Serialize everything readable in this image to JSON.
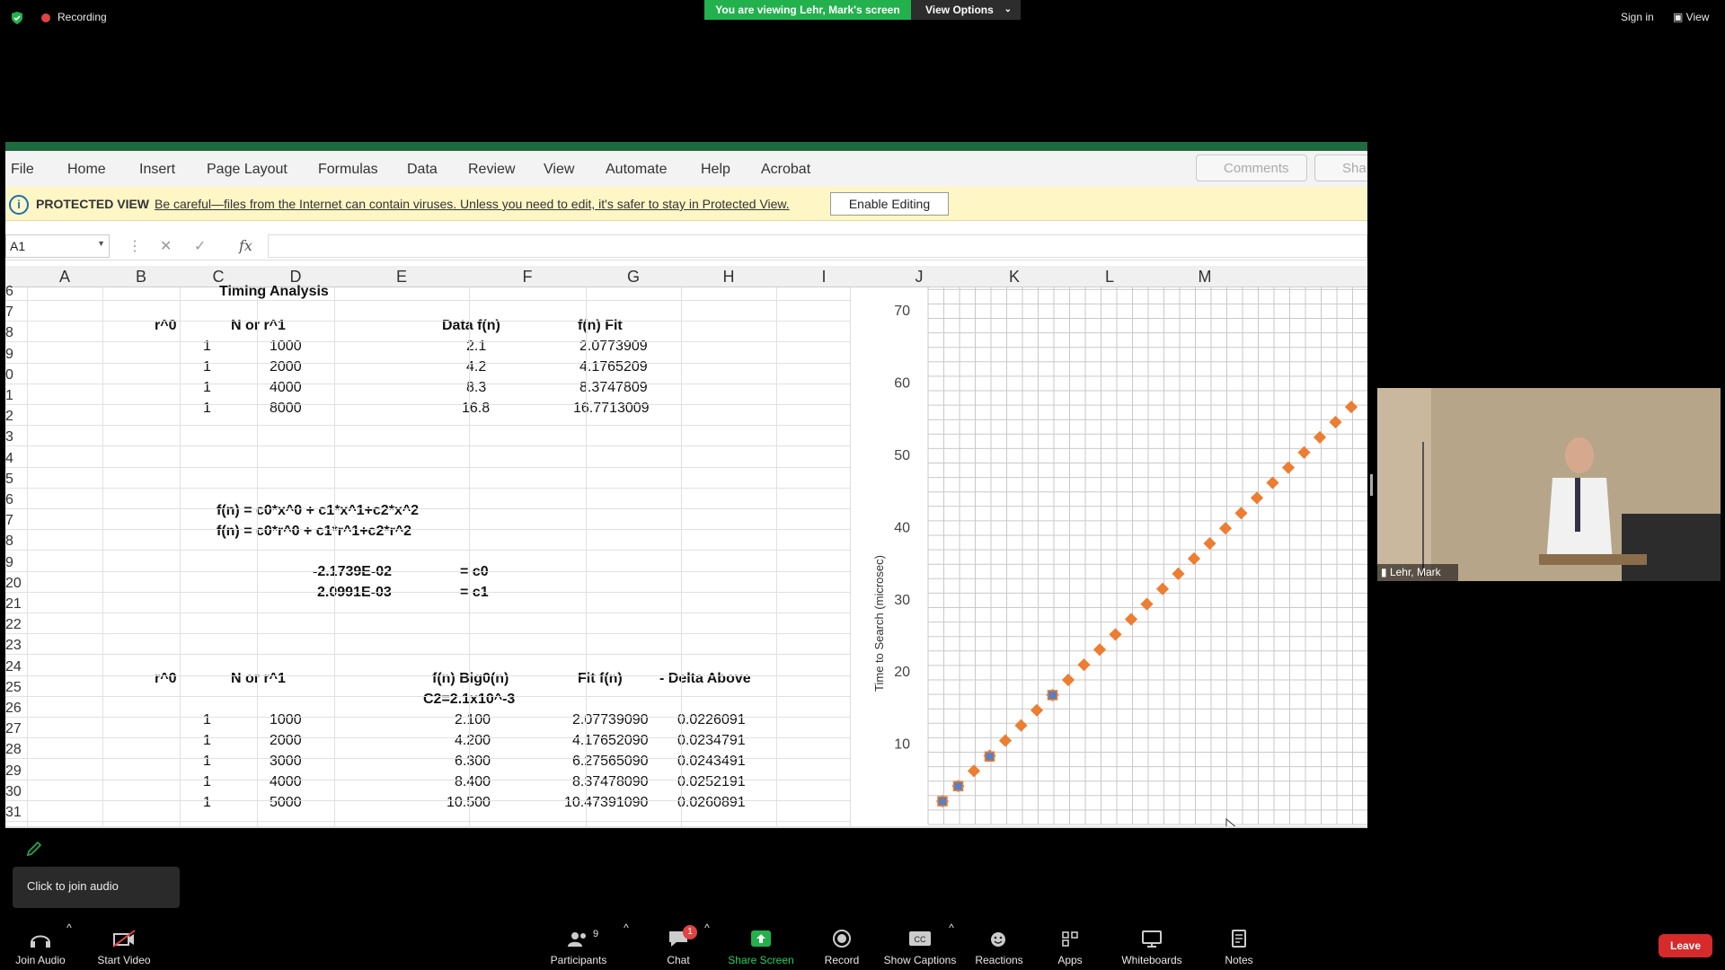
{
  "zoom": {
    "recording": "Recording",
    "viewing_banner": "You are viewing Lehr, Mark's screen",
    "view_options": "View Options",
    "sign_in": "Sign in",
    "view": "View",
    "participant_name": "Lehr, Mark",
    "join_audio_popup": "Click to join audio",
    "toolbar": {
      "join_audio": "Join Audio",
      "start_video": "Start Video",
      "participants": "Participants",
      "participants_count": "9",
      "chat": "Chat",
      "chat_badge": "1",
      "share_screen": "Share Screen",
      "record": "Record",
      "show_captions": "Show Captions",
      "reactions": "Reactions",
      "apps": "Apps",
      "whiteboards": "Whiteboards",
      "notes": "Notes",
      "leave": "Leave"
    }
  },
  "excel": {
    "ribbon_tabs": [
      "File",
      "Home",
      "Insert",
      "Page Layout",
      "Formulas",
      "Data",
      "Review",
      "View",
      "Automate",
      "Help",
      "Acrobat"
    ],
    "comments": "Comments",
    "share": "Sha",
    "protected_label": "PROTECTED VIEW",
    "protected_msg": "Be careful—files from the Internet can contain viruses. Unless you need to edit, it's safer to stay in Protected View.",
    "enable_editing": "Enable Editing",
    "name_box": "A1",
    "fx": "fx",
    "columns": [
      "A",
      "B",
      "C",
      "D",
      "E",
      "F",
      "G",
      "H",
      "I",
      "J",
      "K",
      "L",
      "M"
    ],
    "row_numbers": [
      "6",
      "7",
      "8",
      "9",
      "0",
      "1",
      "2",
      "3",
      "4",
      "5",
      "6",
      "7",
      "8",
      "9",
      "20",
      "21",
      "22",
      "23",
      "24",
      "25",
      "26",
      "27",
      "28",
      "29",
      "30",
      "31"
    ],
    "title": "Timing Analysis",
    "table1": {
      "headers": [
        "r^0",
        "N or r^1",
        "Data f(n)",
        "f(n) Fit"
      ],
      "rows": [
        [
          "1",
          "1000",
          "2.1",
          "2.0773909"
        ],
        [
          "1",
          "2000",
          "4.2",
          "4.1765209"
        ],
        [
          "1",
          "4000",
          "8.3",
          "8.3747809"
        ],
        [
          "1",
          "8000",
          "16.8",
          "16.7713009"
        ]
      ]
    },
    "formula1": "f(n) = c0*x^0 + c1*x^1+c2*x^2",
    "formula2": "f(n) = c0*r^0 + c1*r^1+c2*r^2",
    "coef": [
      {
        "value": "-2.1739E-02",
        "label": "= c0"
      },
      {
        "value": "2.0991E-03",
        "label": "= c1"
      }
    ],
    "table2": {
      "headers": [
        "r^0",
        "N or r^1",
        "f(n) Big0(n)",
        "Fit f(n)",
        "- Delta Above"
      ],
      "subheader": "C2=2.1x10^-3",
      "rows": [
        [
          "1",
          "1000",
          "2.100",
          "2.07739090",
          "0.0226091"
        ],
        [
          "1",
          "2000",
          "4.200",
          "4.17652090",
          "0.0234791"
        ],
        [
          "1",
          "3000",
          "6.300",
          "6.27565090",
          "0.0243491"
        ],
        [
          "1",
          "4000",
          "8.400",
          "8.37478090",
          "0.0252191"
        ],
        [
          "1",
          "5000",
          "10.500",
          "10.47391090",
          "0.0260891"
        ]
      ]
    }
  },
  "chart_data": {
    "type": "scatter",
    "ylabel": "Time to Search (microsec)",
    "yticks": [
      "10",
      "20",
      "30",
      "40",
      "50",
      "60",
      "70"
    ],
    "ylim": [
      0,
      70
    ],
    "x": [
      1000,
      2000,
      3000,
      4000,
      5000,
      6000,
      7000,
      8000,
      9000,
      10000,
      11000,
      12000,
      13000,
      14000,
      15000,
      16000,
      17000,
      18000,
      19000,
      20000,
      21000,
      22000,
      23000,
      24000,
      25000,
      26000,
      27000,
      28000
    ],
    "series": [
      {
        "values": [
          2.1,
          4.2,
          6.3,
          8.4,
          10.5,
          12.6,
          14.7,
          16.8,
          18.9,
          21.0,
          23.1,
          25.2,
          27.3,
          29.4,
          31.5,
          33.6,
          35.7,
          37.8,
          39.9,
          42.0,
          44.1,
          46.2,
          48.3,
          50.4,
          52.5,
          54.6,
          56.7,
          58.8
        ],
        "color": "#ed7d31"
      },
      {
        "values": [
          2.1,
          4.2,
          8.3,
          16.8
        ],
        "x": [
          1000,
          2000,
          4000,
          8000
        ],
        "color": "#5b7fbf"
      }
    ],
    "grid": true
  }
}
